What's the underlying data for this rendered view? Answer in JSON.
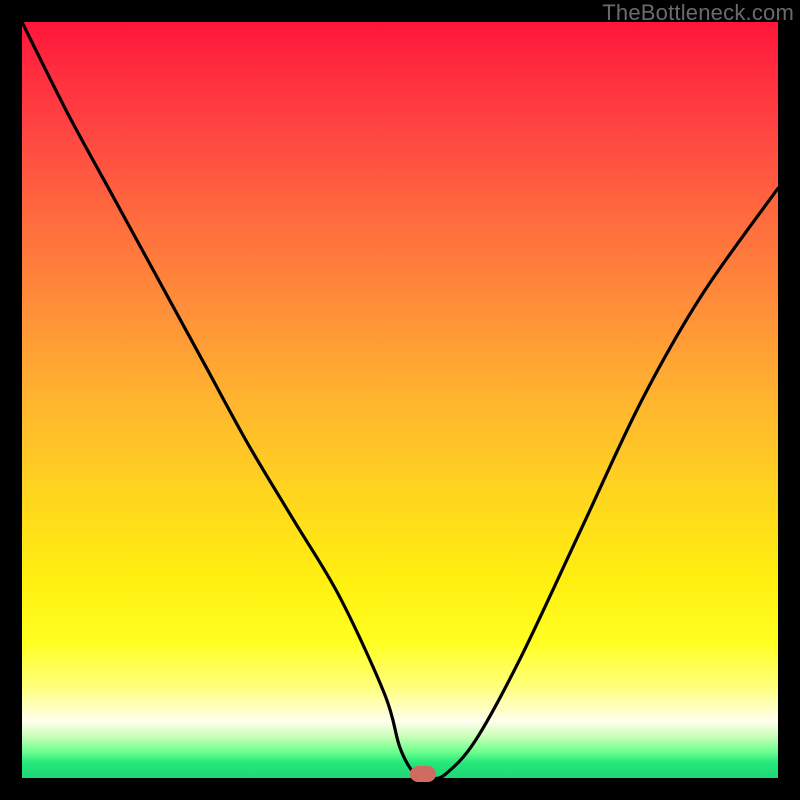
{
  "watermark": "TheBottleneck.com",
  "colors": {
    "frame_bg": "#000000",
    "curve": "#000000",
    "marker": "#cf6b60"
  },
  "chart_data": {
    "type": "line",
    "title": "",
    "xlabel": "",
    "ylabel": "",
    "xlim": [
      0,
      100
    ],
    "ylim": [
      0,
      100
    ],
    "grid": false,
    "legend": false,
    "series": [
      {
        "name": "bottleneck-curve",
        "x": [
          0,
          6,
          12,
          18,
          24,
          30,
          36,
          42,
          48,
          50,
          52,
          54,
          56,
          60,
          66,
          74,
          82,
          90,
          100
        ],
        "values": [
          100,
          88,
          77,
          66,
          55,
          44,
          34,
          24,
          11,
          4,
          0.5,
          0,
          0.5,
          5,
          16,
          33,
          50,
          64,
          78
        ]
      }
    ],
    "marker": {
      "x": 53,
      "y": 0.5
    },
    "gradient_stops": [
      {
        "pos": 0,
        "color": "#ff153a"
      },
      {
        "pos": 0.5,
        "color": "#ffb42f"
      },
      {
        "pos": 0.82,
        "color": "#ffff22"
      },
      {
        "pos": 0.94,
        "color": "#c9ffb8"
      },
      {
        "pos": 1.0,
        "color": "#1ed876"
      }
    ]
  }
}
